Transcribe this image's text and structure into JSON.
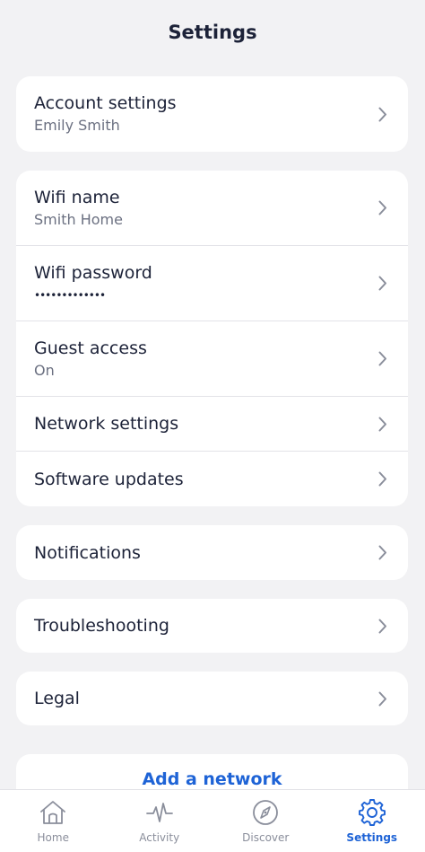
{
  "header": {
    "title": "Settings"
  },
  "account_card": {
    "rows": [
      {
        "label": "Account settings",
        "sub": "Emily Smith"
      }
    ]
  },
  "network_card": {
    "rows": [
      {
        "label": "Wifi name",
        "sub": "Smith Home"
      },
      {
        "label": "Wifi password",
        "sub": "•••••••••••••"
      },
      {
        "label": "Guest access",
        "sub": "On"
      },
      {
        "label": "Network settings"
      },
      {
        "label": "Software updates"
      }
    ]
  },
  "notifications_card": {
    "label": "Notifications"
  },
  "troubleshooting_card": {
    "label": "Troubleshooting"
  },
  "legal_card": {
    "label": "Legal"
  },
  "add_network": {
    "label": "Add a network"
  },
  "tabbar": {
    "tabs": [
      {
        "label": "Home",
        "icon": "home-icon"
      },
      {
        "label": "Activity",
        "icon": "activity-icon"
      },
      {
        "label": "Discover",
        "icon": "compass-icon"
      },
      {
        "label": "Settings",
        "icon": "gear-icon",
        "active": true
      }
    ]
  },
  "colors": {
    "accent": "#1e63d6",
    "text": "#1c2238",
    "subtext": "#6b7081",
    "background": "#f2f2f4",
    "chevron": "#8a8e9b"
  }
}
